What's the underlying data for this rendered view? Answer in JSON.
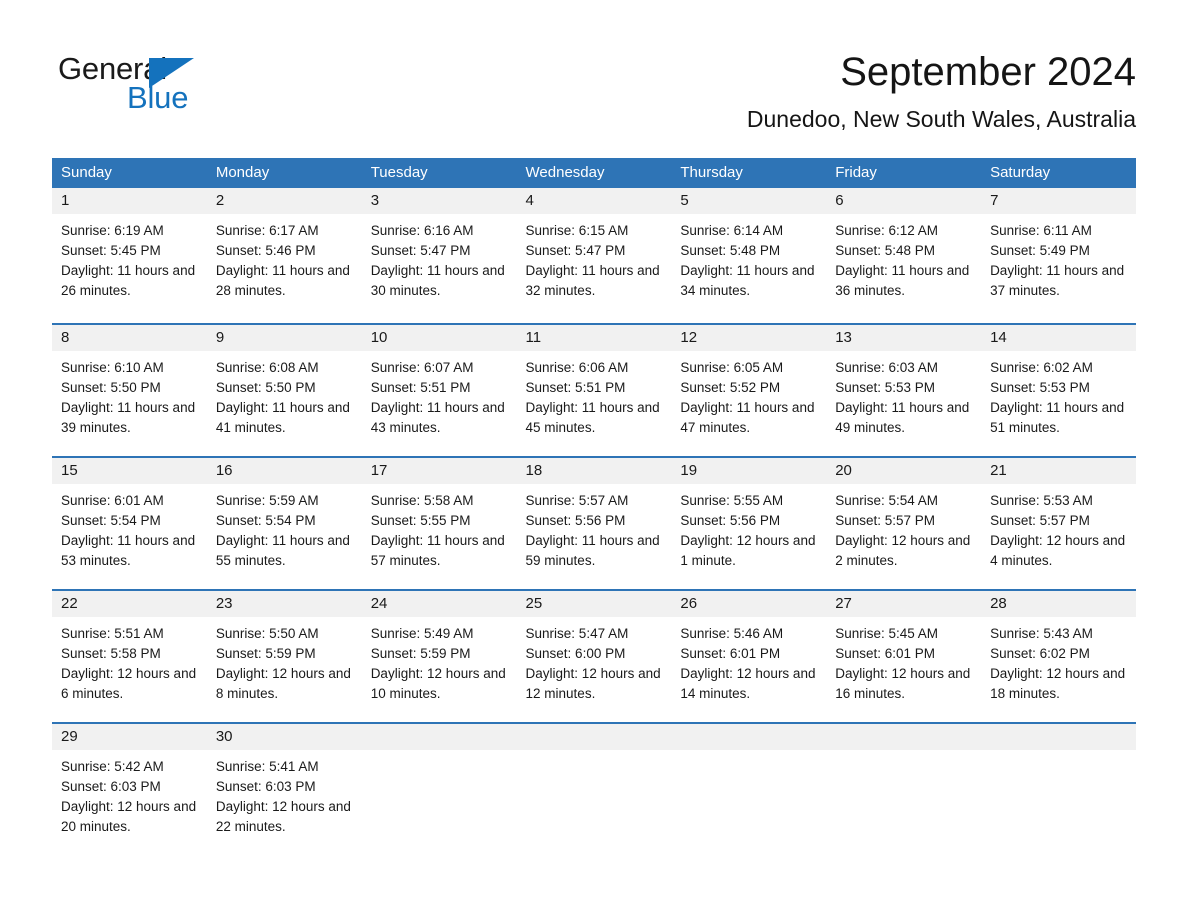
{
  "logo": {
    "text_general": "General",
    "text_blue": "Blue",
    "accent_color": "#1472bd"
  },
  "header": {
    "month_title": "September 2024",
    "location": "Dunedoo, New South Wales, Australia"
  },
  "calendar": {
    "header_color": "#2e74b6",
    "daynum_band_color": "#f1f1f1",
    "weekdays": [
      "Sunday",
      "Monday",
      "Tuesday",
      "Wednesday",
      "Thursday",
      "Friday",
      "Saturday"
    ],
    "weeks": [
      {
        "days": [
          {
            "num": "1",
            "sunrise": "Sunrise: 6:19 AM",
            "sunset": "Sunset: 5:45 PM",
            "daylight": "Daylight: 11 hours and 26 minutes."
          },
          {
            "num": "2",
            "sunrise": "Sunrise: 6:17 AM",
            "sunset": "Sunset: 5:46 PM",
            "daylight": "Daylight: 11 hours and 28 minutes."
          },
          {
            "num": "3",
            "sunrise": "Sunrise: 6:16 AM",
            "sunset": "Sunset: 5:47 PM",
            "daylight": "Daylight: 11 hours and 30 minutes."
          },
          {
            "num": "4",
            "sunrise": "Sunrise: 6:15 AM",
            "sunset": "Sunset: 5:47 PM",
            "daylight": "Daylight: 11 hours and 32 minutes."
          },
          {
            "num": "5",
            "sunrise": "Sunrise: 6:14 AM",
            "sunset": "Sunset: 5:48 PM",
            "daylight": "Daylight: 11 hours and 34 minutes."
          },
          {
            "num": "6",
            "sunrise": "Sunrise: 6:12 AM",
            "sunset": "Sunset: 5:48 PM",
            "daylight": "Daylight: 11 hours and 36 minutes."
          },
          {
            "num": "7",
            "sunrise": "Sunrise: 6:11 AM",
            "sunset": "Sunset: 5:49 PM",
            "daylight": "Daylight: 11 hours and 37 minutes."
          }
        ]
      },
      {
        "days": [
          {
            "num": "8",
            "sunrise": "Sunrise: 6:10 AM",
            "sunset": "Sunset: 5:50 PM",
            "daylight": "Daylight: 11 hours and 39 minutes."
          },
          {
            "num": "9",
            "sunrise": "Sunrise: 6:08 AM",
            "sunset": "Sunset: 5:50 PM",
            "daylight": "Daylight: 11 hours and 41 minutes."
          },
          {
            "num": "10",
            "sunrise": "Sunrise: 6:07 AM",
            "sunset": "Sunset: 5:51 PM",
            "daylight": "Daylight: 11 hours and 43 minutes."
          },
          {
            "num": "11",
            "sunrise": "Sunrise: 6:06 AM",
            "sunset": "Sunset: 5:51 PM",
            "daylight": "Daylight: 11 hours and 45 minutes."
          },
          {
            "num": "12",
            "sunrise": "Sunrise: 6:05 AM",
            "sunset": "Sunset: 5:52 PM",
            "daylight": "Daylight: 11 hours and 47 minutes."
          },
          {
            "num": "13",
            "sunrise": "Sunrise: 6:03 AM",
            "sunset": "Sunset: 5:53 PM",
            "daylight": "Daylight: 11 hours and 49 minutes."
          },
          {
            "num": "14",
            "sunrise": "Sunrise: 6:02 AM",
            "sunset": "Sunset: 5:53 PM",
            "daylight": "Daylight: 11 hours and 51 minutes."
          }
        ]
      },
      {
        "days": [
          {
            "num": "15",
            "sunrise": "Sunrise: 6:01 AM",
            "sunset": "Sunset: 5:54 PM",
            "daylight": "Daylight: 11 hours and 53 minutes."
          },
          {
            "num": "16",
            "sunrise": "Sunrise: 5:59 AM",
            "sunset": "Sunset: 5:54 PM",
            "daylight": "Daylight: 11 hours and 55 minutes."
          },
          {
            "num": "17",
            "sunrise": "Sunrise: 5:58 AM",
            "sunset": "Sunset: 5:55 PM",
            "daylight": "Daylight: 11 hours and 57 minutes."
          },
          {
            "num": "18",
            "sunrise": "Sunrise: 5:57 AM",
            "sunset": "Sunset: 5:56 PM",
            "daylight": "Daylight: 11 hours and 59 minutes."
          },
          {
            "num": "19",
            "sunrise": "Sunrise: 5:55 AM",
            "sunset": "Sunset: 5:56 PM",
            "daylight": "Daylight: 12 hours and 1 minute."
          },
          {
            "num": "20",
            "sunrise": "Sunrise: 5:54 AM",
            "sunset": "Sunset: 5:57 PM",
            "daylight": "Daylight: 12 hours and 2 minutes."
          },
          {
            "num": "21",
            "sunrise": "Sunrise: 5:53 AM",
            "sunset": "Sunset: 5:57 PM",
            "daylight": "Daylight: 12 hours and 4 minutes."
          }
        ]
      },
      {
        "days": [
          {
            "num": "22",
            "sunrise": "Sunrise: 5:51 AM",
            "sunset": "Sunset: 5:58 PM",
            "daylight": "Daylight: 12 hours and 6 minutes."
          },
          {
            "num": "23",
            "sunrise": "Sunrise: 5:50 AM",
            "sunset": "Sunset: 5:59 PM",
            "daylight": "Daylight: 12 hours and 8 minutes."
          },
          {
            "num": "24",
            "sunrise": "Sunrise: 5:49 AM",
            "sunset": "Sunset: 5:59 PM",
            "daylight": "Daylight: 12 hours and 10 minutes."
          },
          {
            "num": "25",
            "sunrise": "Sunrise: 5:47 AM",
            "sunset": "Sunset: 6:00 PM",
            "daylight": "Daylight: 12 hours and 12 minutes."
          },
          {
            "num": "26",
            "sunrise": "Sunrise: 5:46 AM",
            "sunset": "Sunset: 6:01 PM",
            "daylight": "Daylight: 12 hours and 14 minutes."
          },
          {
            "num": "27",
            "sunrise": "Sunrise: 5:45 AM",
            "sunset": "Sunset: 6:01 PM",
            "daylight": "Daylight: 12 hours and 16 minutes."
          },
          {
            "num": "28",
            "sunrise": "Sunrise: 5:43 AM",
            "sunset": "Sunset: 6:02 PM",
            "daylight": "Daylight: 12 hours and 18 minutes."
          }
        ]
      },
      {
        "days": [
          {
            "num": "29",
            "sunrise": "Sunrise: 5:42 AM",
            "sunset": "Sunset: 6:03 PM",
            "daylight": "Daylight: 12 hours and 20 minutes."
          },
          {
            "num": "30",
            "sunrise": "Sunrise: 5:41 AM",
            "sunset": "Sunset: 6:03 PM",
            "daylight": "Daylight: 12 hours and 22 minutes."
          },
          {
            "num": "",
            "sunrise": "",
            "sunset": "",
            "daylight": ""
          },
          {
            "num": "",
            "sunrise": "",
            "sunset": "",
            "daylight": ""
          },
          {
            "num": "",
            "sunrise": "",
            "sunset": "",
            "daylight": ""
          },
          {
            "num": "",
            "sunrise": "",
            "sunset": "",
            "daylight": ""
          },
          {
            "num": "",
            "sunrise": "",
            "sunset": "",
            "daylight": ""
          }
        ]
      }
    ]
  }
}
